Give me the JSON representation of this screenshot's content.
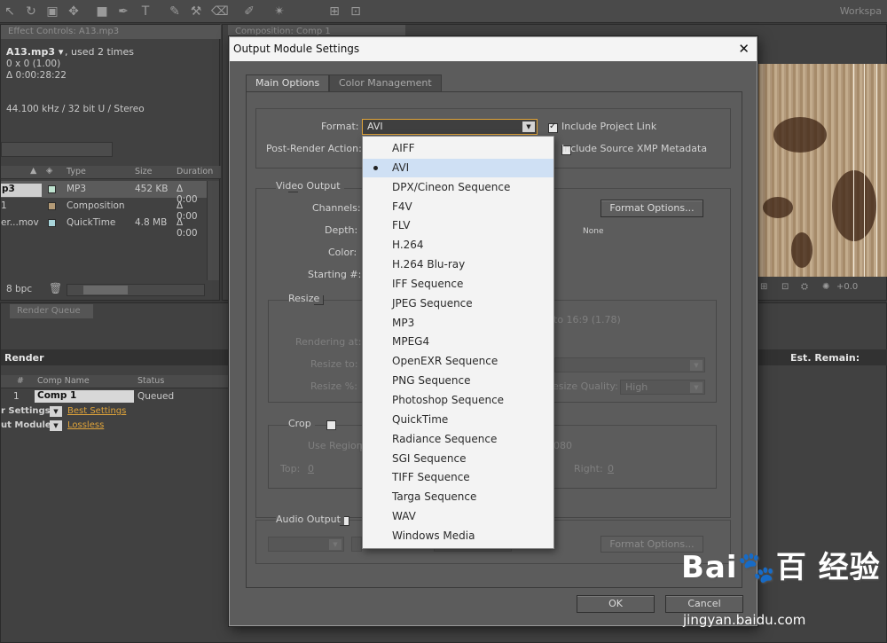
{
  "toolbar": {
    "workspace": "Workspa"
  },
  "effect_panel": {
    "tab": "Effect Controls: A13.mp3",
    "file_name": "A13.mp3 ▾",
    "used": ", used 2 times",
    "dims": "0 x 0 (1.00)",
    "duration": "Δ 0:00:28:22",
    "audio_info": "44.100 kHz / 32 bit U / Stereo",
    "bpc": "8 bpc",
    "columns": {
      "type": "Type",
      "size": "Size",
      "duration": "Duration"
    },
    "rows": [
      {
        "name": "p3",
        "color": "#bfe3d0",
        "type": "MP3",
        "size": "452 KB",
        "duration": "Δ 0:00"
      },
      {
        "name": "1",
        "color": "#b39a76",
        "type": "Composition",
        "size": "",
        "duration": "Δ 0:00"
      },
      {
        "name": "er...mov",
        "color": "#a8d4da",
        "type": "QuickTime",
        "size": "4.8 MB",
        "duration": "Δ 0:00"
      }
    ]
  },
  "composition_tab": "Composition: Comp 1",
  "render_queue": {
    "tab": "Render Queue",
    "render_label": "Render",
    "est_remain": "Est. Remain:",
    "columns": {
      "num": "#",
      "comp": "Comp Name",
      "status": "Status"
    },
    "row": {
      "num": "1",
      "comp": "Comp 1",
      "status": "Queued"
    },
    "render_settings_label": "r Settings:",
    "render_settings_value": "Best Settings",
    "output_module_label": "ut Module:",
    "output_module_value": "Lossless"
  },
  "dialog": {
    "title": "Output Module Settings",
    "close": "✕",
    "tabs": [
      "Main Options",
      "Color Management"
    ],
    "format_label": "Format:",
    "format_value": "AVI",
    "post_render_label": "Post-Render Action:",
    "include_project_link": "Include Project Link",
    "include_xmp": "Include Source XMP Metadata",
    "video_output": "Video Output",
    "channels": "Channels:",
    "depth": "Depth:",
    "color": "Color:",
    "starting": "Starting #:",
    "format_options": "Format Options...",
    "none": "None",
    "resize": "Resize",
    "ratio": "to 16:9 (1.78)",
    "rendering_at": "Rendering at:",
    "resize_to": "Resize to:",
    "resize_pct": "Resize %:",
    "resize_quality": "esize Quality:",
    "quality_value": "High",
    "crop": "Crop",
    "use_region": "Use Region",
    "crop_value": "080",
    "top": "Top:",
    "top_value": "0",
    "right": "Right:",
    "right_value": "0",
    "audio_output": "Audio Output",
    "audio_format_options": "Format Options...",
    "ok": "OK",
    "cancel": "Cancel"
  },
  "dropdown": {
    "selected": "AVI",
    "items": [
      "AIFF",
      "AVI",
      "DPX/Cineon Sequence",
      "F4V",
      "FLV",
      "H.264",
      "H.264 Blu-ray",
      "IFF Sequence",
      "JPEG Sequence",
      "MP3",
      "MPEG4",
      "OpenEXR Sequence",
      "PNG Sequence",
      "Photoshop Sequence",
      "QuickTime",
      "Radiance Sequence",
      "SGI Sequence",
      "TIFF Sequence",
      "Targa Sequence",
      "WAV",
      "Windows Media"
    ]
  },
  "preview": {
    "zoom": "+0.0"
  },
  "watermark": {
    "logo": "Bai🐾百 经验",
    "url": "jingyan.baidu.com"
  }
}
